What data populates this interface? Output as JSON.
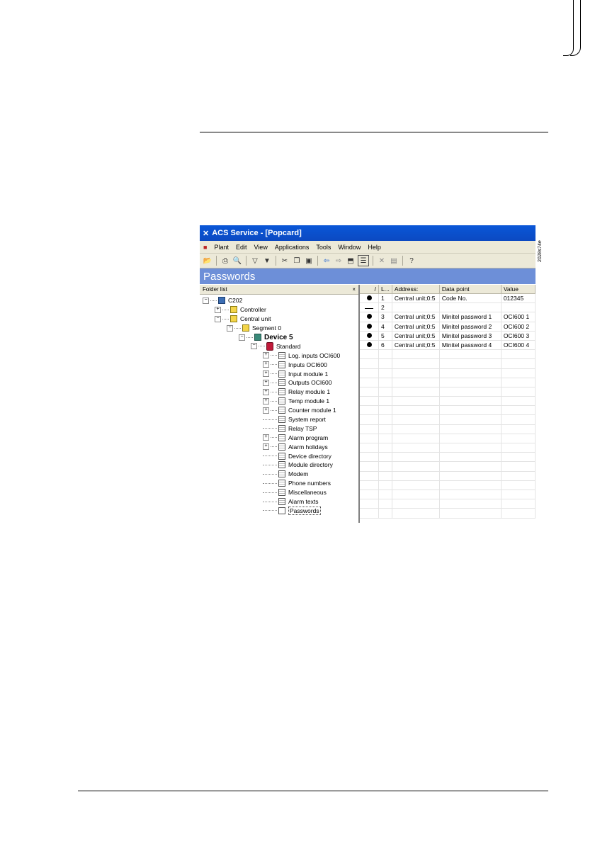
{
  "window": {
    "title": "ACS Service - [Popcard]"
  },
  "figure_id": "2028s74e",
  "menu": [
    "Plant",
    "Edit",
    "View",
    "Applications",
    "Tools",
    "Window",
    "Help"
  ],
  "page_header": "Passwords",
  "folder_list": {
    "title": "Folder list",
    "close": "×"
  },
  "tree": [
    {
      "label": "C202",
      "level": 0,
      "exp": "−",
      "icon": "net"
    },
    {
      "label": "Controller",
      "level": 1,
      "exp": "+",
      "icon": "folder"
    },
    {
      "label": "Central unit",
      "level": 1,
      "exp": "−",
      "icon": "folder"
    },
    {
      "label": "Segment 0",
      "level": 2,
      "exp": "−",
      "icon": "folder"
    },
    {
      "label": "Device 5",
      "level": 3,
      "exp": "−",
      "icon": "dev",
      "bold": true
    },
    {
      "label": "Standard",
      "level": 4,
      "exp": "−",
      "icon": "std"
    },
    {
      "label": "Log. inputs OCI600",
      "level": 5,
      "exp": "+",
      "icon": "page"
    },
    {
      "label": "Inputs OCI600",
      "level": 5,
      "exp": "+",
      "icon": "page"
    },
    {
      "label": "Input module 1",
      "level": 5,
      "exp": "+",
      "icon": "page"
    },
    {
      "label": "Outputs OCI600",
      "level": 5,
      "exp": "+",
      "icon": "page"
    },
    {
      "label": "Relay module 1",
      "level": 5,
      "exp": "+",
      "icon": "page"
    },
    {
      "label": "Temp module 1",
      "level": 5,
      "exp": "+",
      "icon": "page"
    },
    {
      "label": "Counter module 1",
      "level": 5,
      "exp": "+",
      "icon": "page"
    },
    {
      "label": "System report",
      "level": 5,
      "exp": "",
      "icon": "page"
    },
    {
      "label": "Relay TSP",
      "level": 5,
      "exp": "",
      "icon": "page"
    },
    {
      "label": "Alarm program",
      "level": 5,
      "exp": "+",
      "icon": "page"
    },
    {
      "label": "Alarm holidays",
      "level": 5,
      "exp": "+",
      "icon": "page"
    },
    {
      "label": "Device directory",
      "level": 5,
      "exp": "",
      "icon": "page"
    },
    {
      "label": "Module directory",
      "level": 5,
      "exp": "",
      "icon": "page"
    },
    {
      "label": "Modem",
      "level": 5,
      "exp": "",
      "icon": "page"
    },
    {
      "label": "Phone numbers",
      "level": 5,
      "exp": "",
      "icon": "page"
    },
    {
      "label": "Miscellaneous",
      "level": 5,
      "exp": "",
      "icon": "page"
    },
    {
      "label": "Alarm texts",
      "level": 5,
      "exp": "",
      "icon": "page"
    },
    {
      "label": "Passwords",
      "level": 5,
      "exp": "",
      "icon": "doc",
      "selected": true
    }
  ],
  "table": {
    "headers": [
      "/",
      "L...",
      "Address:",
      "Data point",
      "Value"
    ],
    "rows": [
      {
        "mark": "dot",
        "line": "1",
        "address": "Central unit;0:5",
        "data_point": "Code No.",
        "value": "012345"
      },
      {
        "mark": "dash",
        "line": "2",
        "address": "",
        "data_point": "",
        "value": ""
      },
      {
        "mark": "dot",
        "line": "3",
        "address": "Central unit;0:5",
        "data_point": "Minitel password 1",
        "value": "OCI600 1"
      },
      {
        "mark": "dot",
        "line": "4",
        "address": "Central unit;0:5",
        "data_point": "Minitel password 2",
        "value": "OCI600 2"
      },
      {
        "mark": "dot",
        "line": "5",
        "address": "Central unit;0:5",
        "data_point": "Minitel password 3",
        "value": "OCI600 3"
      },
      {
        "mark": "dot",
        "line": "6",
        "address": "Central unit;0:5",
        "data_point": "Minitel password 4",
        "value": "OCI600 4"
      }
    ]
  }
}
